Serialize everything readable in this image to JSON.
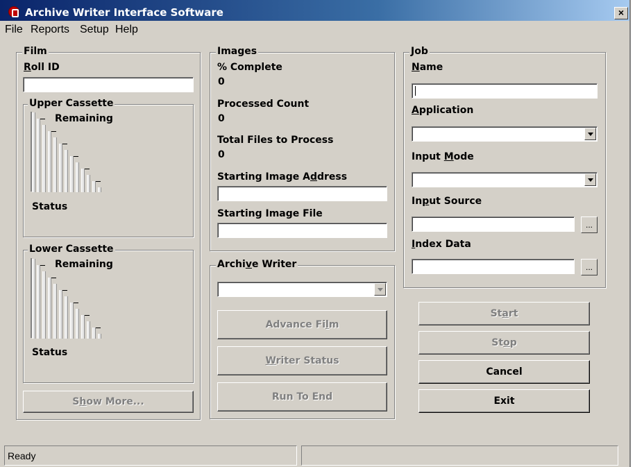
{
  "window": {
    "title": "Archive Writer Interface Software",
    "close_glyph": "×"
  },
  "menu": [
    "File",
    "Reports",
    "Setup",
    "Help"
  ],
  "film": {
    "legend": "Film",
    "roll_id": {
      "label_u": "R",
      "label_rest": "oll ID",
      "value": ""
    },
    "upper_cassette": {
      "legend": "Upper Cassette",
      "remaining_label": "Remaining",
      "status_label": "Status"
    },
    "lower_cassette": {
      "legend": "Lower Cassette",
      "remaining_label": "Remaining",
      "status_label": "Status"
    },
    "show_more": {
      "pre": "S",
      "u": "h",
      "post": "ow More..."
    }
  },
  "images": {
    "legend": "Images",
    "percent_complete": {
      "label": "% Complete",
      "value": "0"
    },
    "processed_count": {
      "label": "Processed Count",
      "value": "0"
    },
    "total_files": {
      "label": "Total Files to Process",
      "value": "0"
    },
    "starting_address": {
      "pre": "Starting Image A",
      "u": "d",
      "post": "dress",
      "value": ""
    },
    "starting_file": {
      "label": "Starting Image File",
      "value": ""
    }
  },
  "archive_writer": {
    "legend_pre": "Archi",
    "legend_u": "v",
    "legend_post": "e Writer",
    "selected": "",
    "advance_film": {
      "pre": "Advance Fi",
      "u": "l",
      "post": "m"
    },
    "writer_status": {
      "u": "W",
      "post": "riter Status"
    },
    "run_to_end": "Run To End"
  },
  "job": {
    "legend": "Job",
    "name": {
      "u": "N",
      "post": "ame",
      "value": ""
    },
    "application": {
      "u": "A",
      "post": "pplication",
      "selected": ""
    },
    "input_mode": {
      "pre": "Input ",
      "u": "M",
      "post": "ode",
      "selected": ""
    },
    "input_source": {
      "pre": "In",
      "u": "p",
      "post": "ut Source",
      "value": "",
      "browse": "..."
    },
    "index_data": {
      "u": "I",
      "post": "ndex Data",
      "value": "",
      "browse": "..."
    }
  },
  "actions": {
    "start": {
      "pre": "St",
      "u": "a",
      "post": "rt"
    },
    "stop": {
      "pre": "St",
      "u": "o",
      "post": "p"
    },
    "cancel": "Cancel",
    "exit": "Exit"
  },
  "statusbar": {
    "text": "Ready",
    "pane2": ""
  },
  "colors": {
    "face": "#d4d0c8",
    "title_start": "#0a246a",
    "title_end": "#a6caf0",
    "app_icon": "#c00000"
  },
  "icons": [
    "app-icon",
    "close-icon",
    "dropdown-arrow-icon",
    "browse-icon"
  ]
}
